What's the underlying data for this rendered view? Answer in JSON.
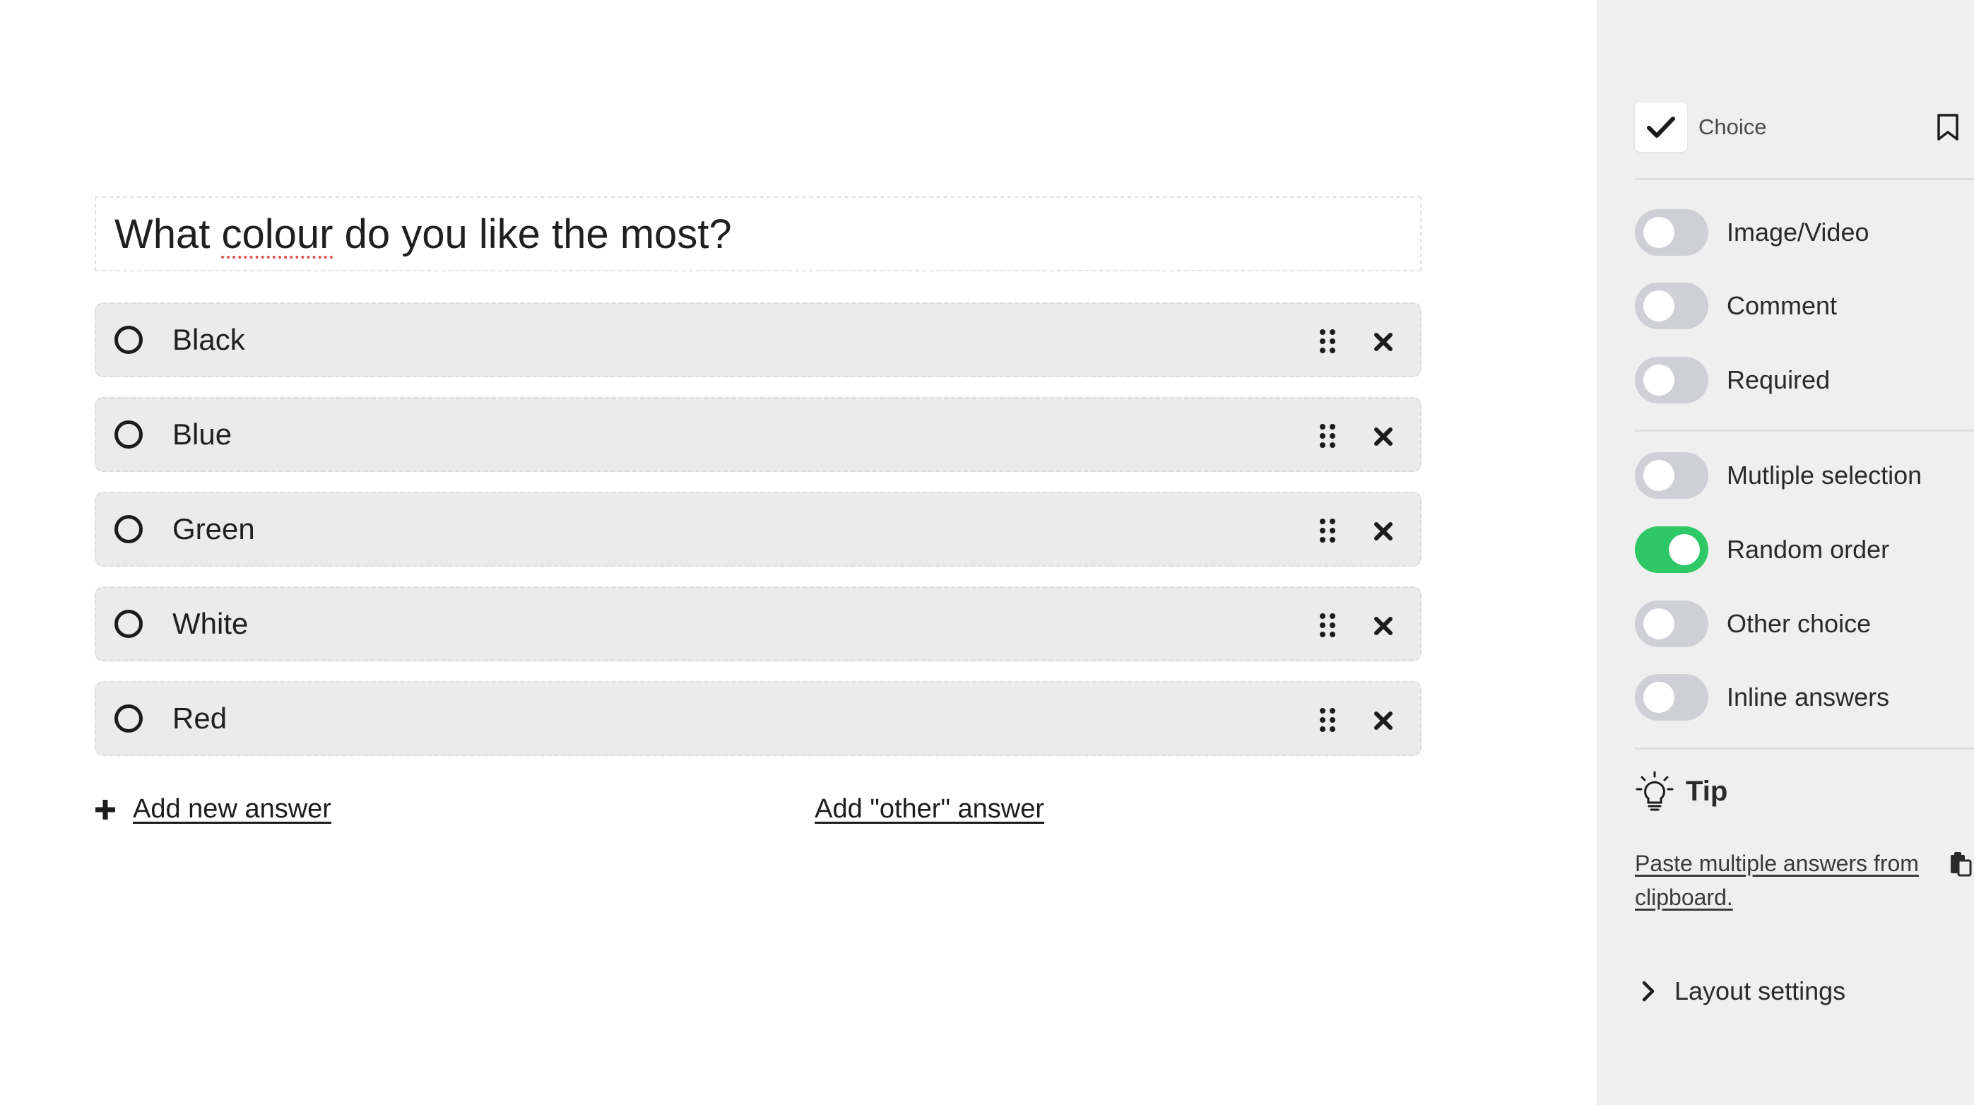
{
  "question": {
    "prefix": "What ",
    "misspelled_word": "colour",
    "suffix": " do you like the most?"
  },
  "answers": [
    {
      "label": "Black"
    },
    {
      "label": "Blue"
    },
    {
      "label": "Green"
    },
    {
      "label": "White"
    },
    {
      "label": "Red"
    }
  ],
  "actions": {
    "add_new": "Add new answer",
    "add_other": "Add \"other\" answer"
  },
  "panel": {
    "type_label": "Choice",
    "toggles": [
      {
        "label": "Image/Video",
        "on": false
      },
      {
        "label": "Comment",
        "on": false
      },
      {
        "label": "Required",
        "on": false
      },
      {
        "label": "Mutliple selection",
        "on": false
      },
      {
        "label": "Random order",
        "on": true
      },
      {
        "label": "Other choice",
        "on": false
      },
      {
        "label": "Inline answers",
        "on": false
      }
    ],
    "tip_title": "Tip",
    "tip_link": "Paste multiple answers from clipboard.",
    "layout_settings": "Layout settings"
  },
  "colors": {
    "toggle_on": "#2ec866",
    "toggle_off": "#cfcfd6",
    "panel_bg": "#efefef",
    "answer_bg": "#ebebeb"
  }
}
